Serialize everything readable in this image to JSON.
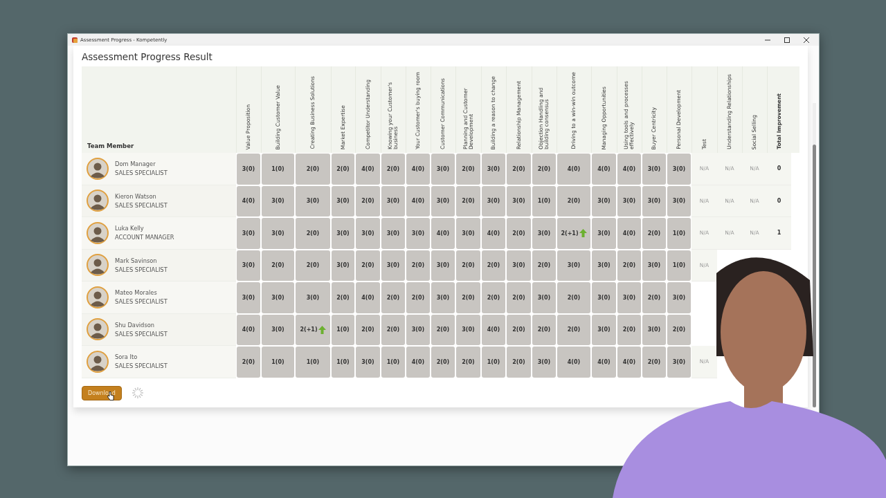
{
  "window": {
    "title": "Assessment Progress - Kompetently"
  },
  "page": {
    "title": "Assessment Progress Result"
  },
  "table": {
    "member_heading": "Team Member",
    "skill_columns": [
      "Value Proposition",
      "Building Customer Value",
      "Creating Business Solutions",
      "Market Expertise",
      "Competitor Understanding",
      "Knowing your Customer's business",
      "Your Customer's buying room",
      "Customer Communications",
      "Planning and Customer Development",
      "Building a reason to change",
      "Relationship Management",
      "Objection Handling and building consensus",
      "Driving to a win-win outcome",
      "Managing Opportunities",
      "Using tools and processes effectively",
      "Buyer Centricity",
      "Personal Development"
    ],
    "extra_columns": [
      {
        "label": "Test",
        "kind": "rating"
      },
      {
        "label": "Understanding Relationships",
        "kind": "rating"
      },
      {
        "label": "Social Selling",
        "kind": "rating"
      },
      {
        "label": "Total Improvement",
        "kind": "total"
      }
    ],
    "rows": [
      {
        "name": "Dom Manager",
        "role": "SALES SPECIALIST",
        "scores": [
          {
            "value": "3(0)",
            "improved": false
          },
          {
            "value": "1(0)",
            "improved": false
          },
          {
            "value": "2(0)",
            "improved": false
          },
          {
            "value": "2(0)",
            "improved": false
          },
          {
            "value": "4(0)",
            "improved": false
          },
          {
            "value": "2(0)",
            "improved": false
          },
          {
            "value": "4(0)",
            "improved": false
          },
          {
            "value": "3(0)",
            "improved": false
          },
          {
            "value": "2(0)",
            "improved": false
          },
          {
            "value": "3(0)",
            "improved": false
          },
          {
            "value": "2(0)",
            "improved": false
          },
          {
            "value": "2(0)",
            "improved": false
          },
          {
            "value": "4(0)",
            "improved": false
          },
          {
            "value": "4(0)",
            "improved": false
          },
          {
            "value": "4(0)",
            "improved": false
          },
          {
            "value": "3(0)",
            "improved": false
          },
          {
            "value": "3(0)",
            "improved": false
          }
        ],
        "extras": [
          "N/A",
          "N/A",
          "N/A",
          "0"
        ]
      },
      {
        "name": "Kieron Watson",
        "role": "SALES SPECIALIST",
        "scores": [
          {
            "value": "4(0)",
            "improved": false
          },
          {
            "value": "3(0)",
            "improved": false
          },
          {
            "value": "3(0)",
            "improved": false
          },
          {
            "value": "3(0)",
            "improved": false
          },
          {
            "value": "2(0)",
            "improved": false
          },
          {
            "value": "3(0)",
            "improved": false
          },
          {
            "value": "4(0)",
            "improved": false
          },
          {
            "value": "3(0)",
            "improved": false
          },
          {
            "value": "2(0)",
            "improved": false
          },
          {
            "value": "3(0)",
            "improved": false
          },
          {
            "value": "3(0)",
            "improved": false
          },
          {
            "value": "1(0)",
            "improved": false
          },
          {
            "value": "2(0)",
            "improved": false
          },
          {
            "value": "3(0)",
            "improved": false
          },
          {
            "value": "3(0)",
            "improved": false
          },
          {
            "value": "3(0)",
            "improved": false
          },
          {
            "value": "3(0)",
            "improved": false
          }
        ],
        "extras": [
          "N/A",
          "N/A",
          "N/A",
          "0"
        ]
      },
      {
        "name": "Luka Kelly",
        "role": "ACCOUNT MANAGER",
        "scores": [
          {
            "value": "3(0)",
            "improved": false
          },
          {
            "value": "3(0)",
            "improved": false
          },
          {
            "value": "2(0)",
            "improved": false
          },
          {
            "value": "3(0)",
            "improved": false
          },
          {
            "value": "3(0)",
            "improved": false
          },
          {
            "value": "3(0)",
            "improved": false
          },
          {
            "value": "3(0)",
            "improved": false
          },
          {
            "value": "4(0)",
            "improved": false
          },
          {
            "value": "3(0)",
            "improved": false
          },
          {
            "value": "4(0)",
            "improved": false
          },
          {
            "value": "2(0)",
            "improved": false
          },
          {
            "value": "3(0)",
            "improved": false
          },
          {
            "value": "2(+1)",
            "improved": true
          },
          {
            "value": "3(0)",
            "improved": false
          },
          {
            "value": "4(0)",
            "improved": false
          },
          {
            "value": "2(0)",
            "improved": false
          },
          {
            "value": "1(0)",
            "improved": false
          }
        ],
        "extras": [
          "N/A",
          "N/A",
          "N/A",
          "1"
        ]
      },
      {
        "name": "Mark Savinson",
        "role": "SALES SPECIALIST",
        "scores": [
          {
            "value": "3(0)",
            "improved": false
          },
          {
            "value": "2(0)",
            "improved": false
          },
          {
            "value": "2(0)",
            "improved": false
          },
          {
            "value": "3(0)",
            "improved": false
          },
          {
            "value": "2(0)",
            "improved": false
          },
          {
            "value": "3(0)",
            "improved": false
          },
          {
            "value": "2(0)",
            "improved": false
          },
          {
            "value": "3(0)",
            "improved": false
          },
          {
            "value": "2(0)",
            "improved": false
          },
          {
            "value": "2(0)",
            "improved": false
          },
          {
            "value": "3(0)",
            "improved": false
          },
          {
            "value": "2(0)",
            "improved": false
          },
          {
            "value": "3(0)",
            "improved": false
          },
          {
            "value": "3(0)",
            "improved": false
          },
          {
            "value": "2(0)",
            "improved": false
          },
          {
            "value": "3(0)",
            "improved": false
          },
          {
            "value": "1(0)",
            "improved": false
          }
        ],
        "extras": [
          "N/A"
        ]
      },
      {
        "name": "Mateo Morales",
        "role": "SALES SPECIALIST",
        "scores": [
          {
            "value": "3(0)",
            "improved": false
          },
          {
            "value": "3(0)",
            "improved": false
          },
          {
            "value": "3(0)",
            "improved": false
          },
          {
            "value": "2(0)",
            "improved": false
          },
          {
            "value": "4(0)",
            "improved": false
          },
          {
            "value": "2(0)",
            "improved": false
          },
          {
            "value": "2(0)",
            "improved": false
          },
          {
            "value": "3(0)",
            "improved": false
          },
          {
            "value": "2(0)",
            "improved": false
          },
          {
            "value": "2(0)",
            "improved": false
          },
          {
            "value": "2(0)",
            "improved": false
          },
          {
            "value": "3(0)",
            "improved": false
          },
          {
            "value": "2(0)",
            "improved": false
          },
          {
            "value": "3(0)",
            "improved": false
          },
          {
            "value": "3(0)",
            "improved": false
          },
          {
            "value": "2(0)",
            "improved": false
          },
          {
            "value": "3(0)",
            "improved": false
          }
        ],
        "extras": []
      },
      {
        "name": "Shu Davidson",
        "role": "SALES SPECIALIST",
        "scores": [
          {
            "value": "4(0)",
            "improved": false
          },
          {
            "value": "3(0)",
            "improved": false
          },
          {
            "value": "2(+1)",
            "improved": true
          },
          {
            "value": "1(0)",
            "improved": false
          },
          {
            "value": "2(0)",
            "improved": false
          },
          {
            "value": "2(0)",
            "improved": false
          },
          {
            "value": "3(0)",
            "improved": false
          },
          {
            "value": "2(0)",
            "improved": false
          },
          {
            "value": "3(0)",
            "improved": false
          },
          {
            "value": "4(0)",
            "improved": false
          },
          {
            "value": "2(0)",
            "improved": false
          },
          {
            "value": "2(0)",
            "improved": false
          },
          {
            "value": "2(0)",
            "improved": false
          },
          {
            "value": "3(0)",
            "improved": false
          },
          {
            "value": "2(0)",
            "improved": false
          },
          {
            "value": "3(0)",
            "improved": false
          },
          {
            "value": "2(0)",
            "improved": false
          }
        ],
        "extras": []
      },
      {
        "name": "Sora Ito",
        "role": "SALES SPECIALIST",
        "scores": [
          {
            "value": "2(0)",
            "improved": false
          },
          {
            "value": "1(0)",
            "improved": false
          },
          {
            "value": "1(0)",
            "improved": false
          },
          {
            "value": "1(0)",
            "improved": false
          },
          {
            "value": "3(0)",
            "improved": false
          },
          {
            "value": "1(0)",
            "improved": false
          },
          {
            "value": "4(0)",
            "improved": false
          },
          {
            "value": "2(0)",
            "improved": false
          },
          {
            "value": "2(0)",
            "improved": false
          },
          {
            "value": "1(0)",
            "improved": false
          },
          {
            "value": "2(0)",
            "improved": false
          },
          {
            "value": "3(0)",
            "improved": false
          },
          {
            "value": "4(0)",
            "improved": false
          },
          {
            "value": "4(0)",
            "improved": false
          },
          {
            "value": "4(0)",
            "improved": false
          },
          {
            "value": "2(0)",
            "improved": false
          },
          {
            "value": "3(0)",
            "improved": false
          }
        ],
        "extras": [
          "N/A"
        ]
      }
    ]
  },
  "download_button": {
    "label": "Download"
  }
}
